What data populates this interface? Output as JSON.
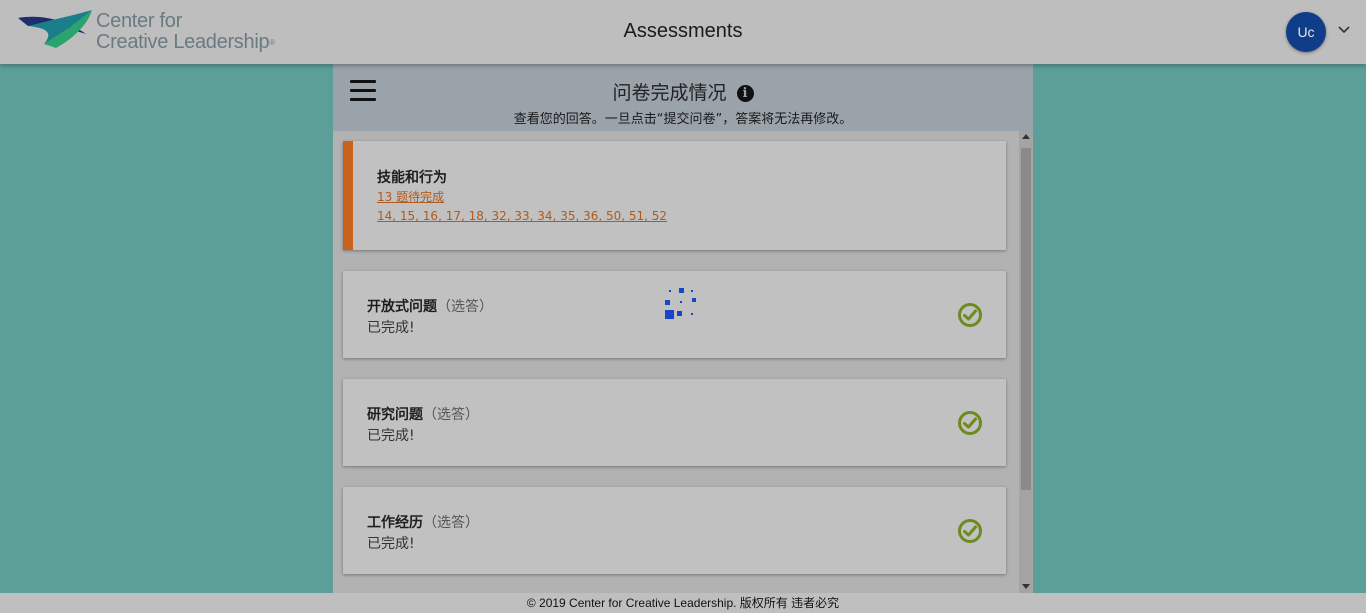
{
  "header": {
    "logo_line1": "Center for",
    "logo_line2": "Creative Leadership",
    "logo_tm": "®",
    "title": "Assessments",
    "avatar_initials": "Uc"
  },
  "panel": {
    "title": "问卷完成情况",
    "info_glyph": "i",
    "subtitle": "查看您的回答。一旦点击“提交问卷”，答案将无法再修改。"
  },
  "sections": [
    {
      "title": "技能和行为",
      "pending_label": "13 题待完成",
      "pending_items": "14, 15, 16, 17, 18, 32, 33, 34, 35, 36, 50, 51, 52"
    },
    {
      "title": "开放式问题",
      "optional": "（选答）",
      "status": "已完成!"
    },
    {
      "title": "研究问题",
      "optional": "（选答）",
      "status": "已完成!"
    },
    {
      "title": "工作经历",
      "optional": "（选答）",
      "status": "已完成!"
    }
  ],
  "footer": {
    "text": "© 2019 Center for Creative Leadership. 版权所有 违者必究"
  },
  "colors": {
    "background": "#5b9f98",
    "accent_warning": "#c8621c",
    "check_green": "#6e8a1f",
    "avatar_blue": "#0f3d8a",
    "spinner_blue": "#1747c9"
  },
  "icons": [
    "ccl-logo",
    "chevron-down-icon",
    "menu-icon",
    "info-icon",
    "check-circle-icon",
    "loading-spinner-icon"
  ]
}
